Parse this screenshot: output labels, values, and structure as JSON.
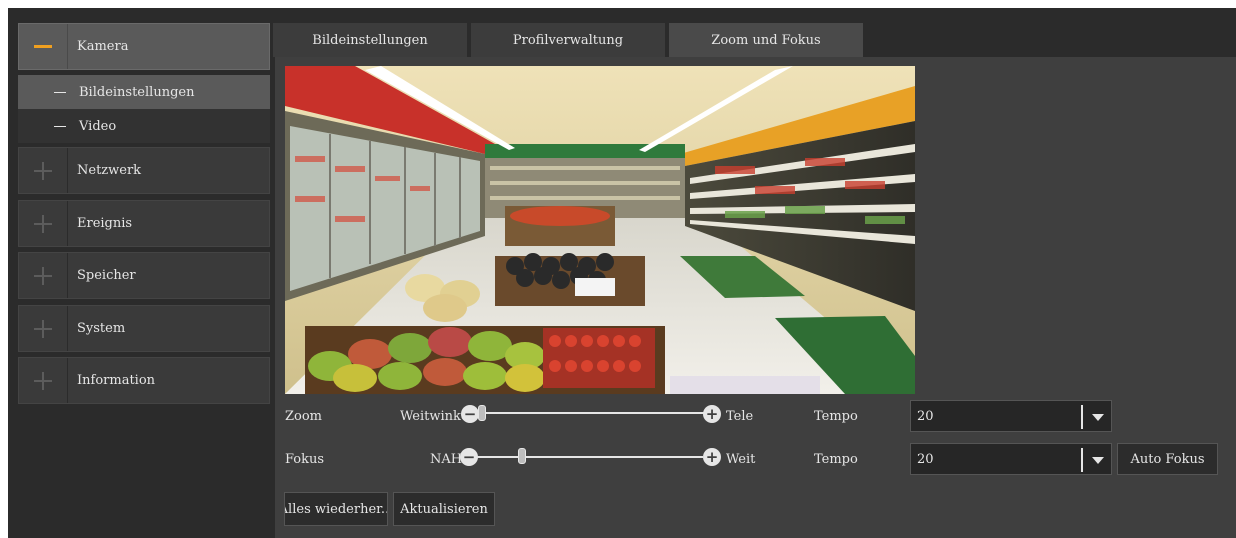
{
  "sidebar": {
    "items": [
      {
        "label": "Kamera",
        "icon": "minus-icon"
      },
      {
        "label": "Netzwerk",
        "icon": "plus-icon"
      },
      {
        "label": "Ereignis",
        "icon": "plus-icon"
      },
      {
        "label": "Speicher",
        "icon": "plus-icon"
      },
      {
        "label": "System",
        "icon": "plus-icon"
      },
      {
        "label": "Information",
        "icon": "plus-icon"
      }
    ],
    "sub_items": [
      {
        "label": "Bildeinstellungen"
      },
      {
        "label": "Video"
      }
    ]
  },
  "tabs": [
    {
      "label": "Bildeinstellungen"
    },
    {
      "label": "Profilverwaltung"
    },
    {
      "label": "Zoom und Fokus"
    }
  ],
  "controls": {
    "zoom": {
      "label": "Zoom",
      "min_label": "Weitwinke",
      "max_label": "Tele",
      "position": 0.0,
      "speed_label": "Tempo",
      "speed_value": "20"
    },
    "focus": {
      "label": "Fokus",
      "min_label": "NAH",
      "max_label": "Weit",
      "position": 0.18,
      "speed_label": "Tempo",
      "speed_value": "20"
    },
    "auto_focus_label": "Auto Fokus"
  },
  "buttons": {
    "restore_label": "Alles wiederher...",
    "refresh_label": "Aktualisieren"
  },
  "colors": {
    "accent": "#f0a020",
    "background": "#2b2b2b",
    "panel": "#3f3f3f"
  }
}
